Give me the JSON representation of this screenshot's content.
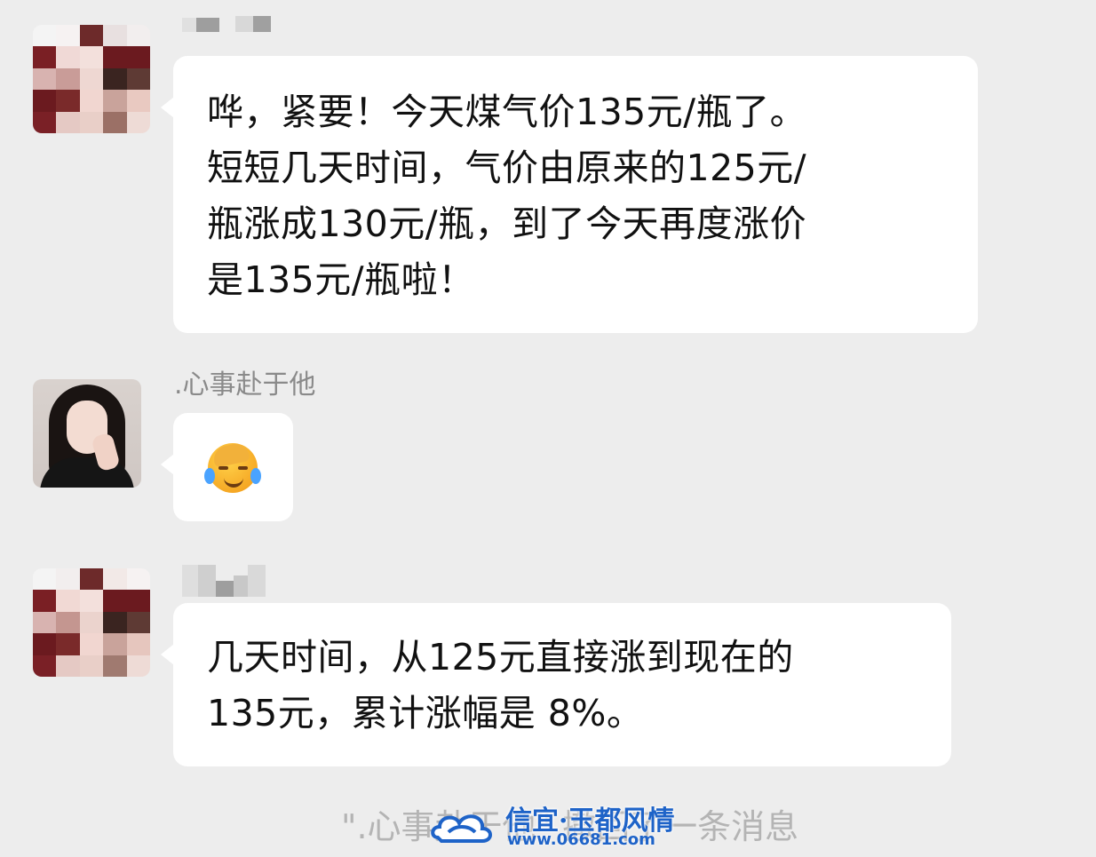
{
  "conversation": {
    "messages": [
      {
        "sender": "",
        "text": "哗，紧要！今天煤气价135元/瓶了。\n短短几天时间，气价由原来的125元/\n瓶涨成130元/瓶，到了今天再度涨价\n是135元/瓶啦！"
      },
      {
        "sender": ".心事赴于他",
        "emoji": "face-palm-crying-emoji"
      },
      {
        "sender": "",
        "text": "几天时间，从125元直接涨到现在的\n135元，累计涨幅是 8%。"
      }
    ],
    "system_notice": "\".心事赴于他\" 撤回了一条消息"
  },
  "watermark": {
    "title": "信宜·玉都风情",
    "url": "www.06681.com"
  },
  "colors": {
    "background": "#ededed",
    "bubble": "#ffffff",
    "sender_name": "#8a8a8a",
    "notice": "#b4b4b4",
    "watermark": "#1e63c8"
  }
}
